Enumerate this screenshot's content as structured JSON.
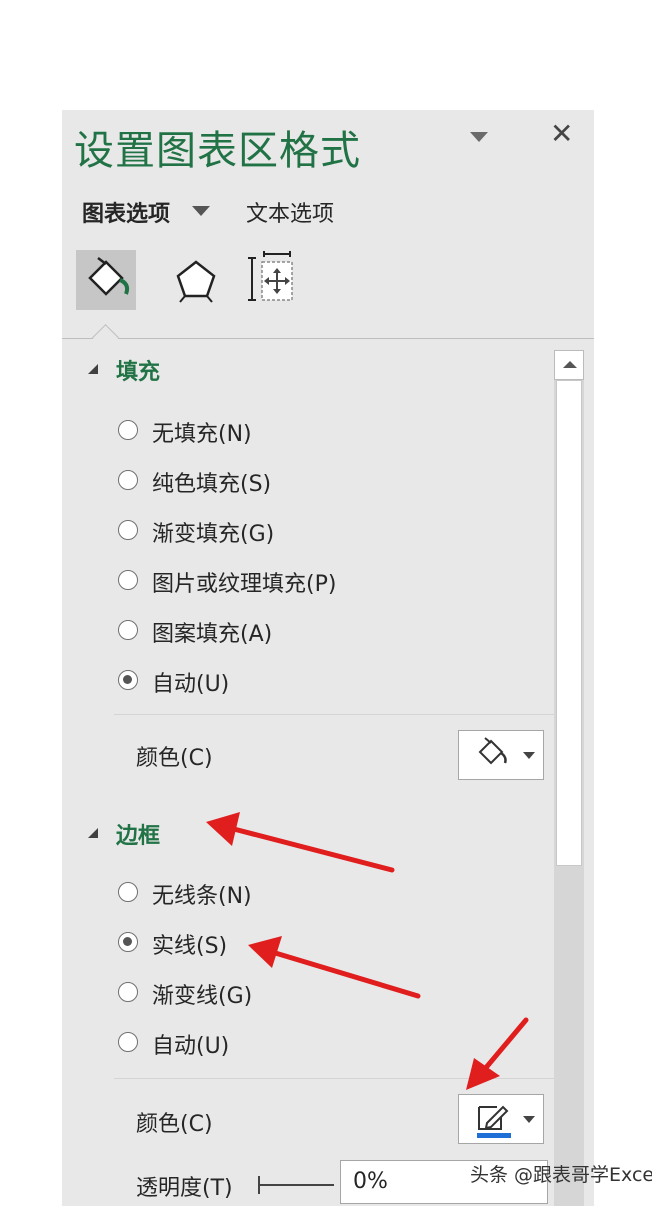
{
  "pane": {
    "title": "设置图表区格式",
    "close_glyph": "✕"
  },
  "tabs": {
    "chart_options": "图表选项",
    "text_options": "文本选项"
  },
  "icon_tabs": [
    "fill-line-icon",
    "effects-pentagon-icon",
    "size-properties-icon"
  ],
  "fill": {
    "header": "填充",
    "options": [
      {
        "label": "无填充(N)",
        "checked": false
      },
      {
        "label": "纯色填充(S)",
        "checked": false
      },
      {
        "label": "渐变填充(G)",
        "checked": false
      },
      {
        "label": "图片或纹理填充(P)",
        "checked": false
      },
      {
        "label": "图案填充(A)",
        "checked": false
      },
      {
        "label": "自动(U)",
        "checked": true
      }
    ],
    "color_label": "颜色(C)"
  },
  "border": {
    "header": "边框",
    "options": [
      {
        "label": "无线条(N)",
        "checked": false
      },
      {
        "label": "实线(S)",
        "checked": true
      },
      {
        "label": "渐变线(G)",
        "checked": false
      },
      {
        "label": "自动(U)",
        "checked": false
      }
    ],
    "color_label": "颜色(C)",
    "line_color": "#1f6fd6",
    "transparency_label": "透明度(T)",
    "transparency_value": "0%"
  },
  "annotations": {
    "arrow_color": "#e01e1e"
  },
  "watermark": "头条 @跟表哥学Excel"
}
